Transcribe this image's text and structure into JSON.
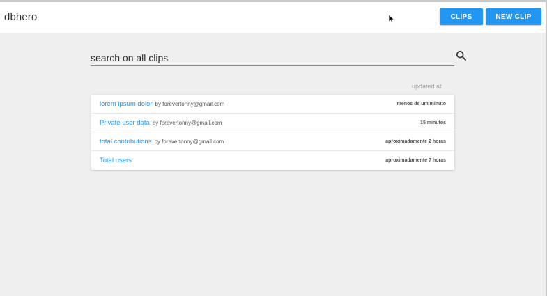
{
  "header": {
    "brand": "dbhero",
    "clips_label": "CLIPS",
    "new_clip_label": "NEW CLIP"
  },
  "search": {
    "placeholder": "search on all clips",
    "value": ""
  },
  "list": {
    "column_label": "updated at",
    "items": [
      {
        "title": "lorem ipsum dolor",
        "author": "by forevertonny@gmail.com",
        "updated": "menos de um minuto"
      },
      {
        "title": "Private user data",
        "author": "by forevertonny@gmail.com",
        "updated": "15 minutos"
      },
      {
        "title": "total contributions",
        "author": "by forevertonny@gmail.com",
        "updated": "aproximadamente 2 horas"
      },
      {
        "title": "Total users",
        "author": "",
        "updated": "aproximadamente 7 horas"
      }
    ]
  },
  "colors": {
    "accent": "#2196f3",
    "background": "#efefef",
    "header_bg": "#ffffff"
  },
  "icons": {
    "search": "search-icon",
    "cursor": "mouse-pointer-icon"
  }
}
